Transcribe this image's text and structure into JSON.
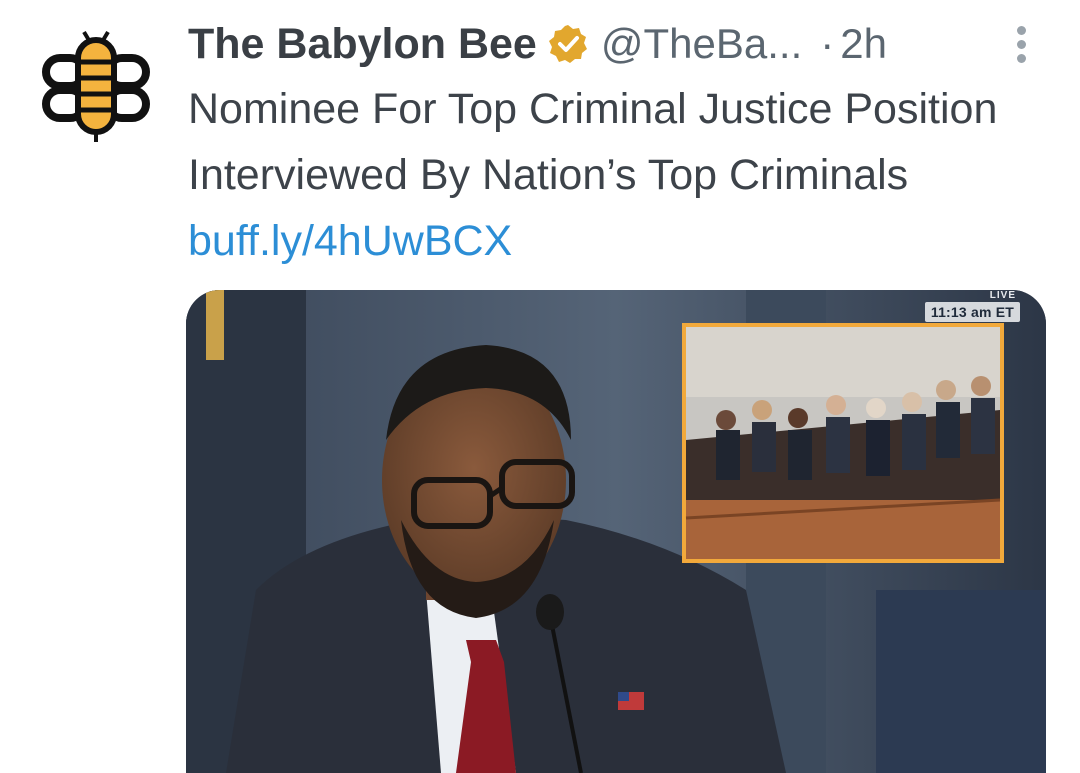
{
  "author": {
    "display_name": "The Babylon Bee",
    "handle": "@TheBa...",
    "separator": "·",
    "time": "2h",
    "avatar_icon": "bee-logo-icon",
    "verified_icon": "verified-badge-icon",
    "verified_color": "#e2a72e"
  },
  "tweet": {
    "text": "Nominee For Top Criminal Justice Position Interviewed By Nation’s Top Criminals",
    "link_text": "buff.ly/4hUwBCX",
    "link_color": "#2c8ed6"
  },
  "media": {
    "live_label": "LIVE",
    "timestamp": "11:13 am ET",
    "inset_border_color": "#f2a93b"
  },
  "menu": {
    "more_icon": "more-options-icon"
  }
}
